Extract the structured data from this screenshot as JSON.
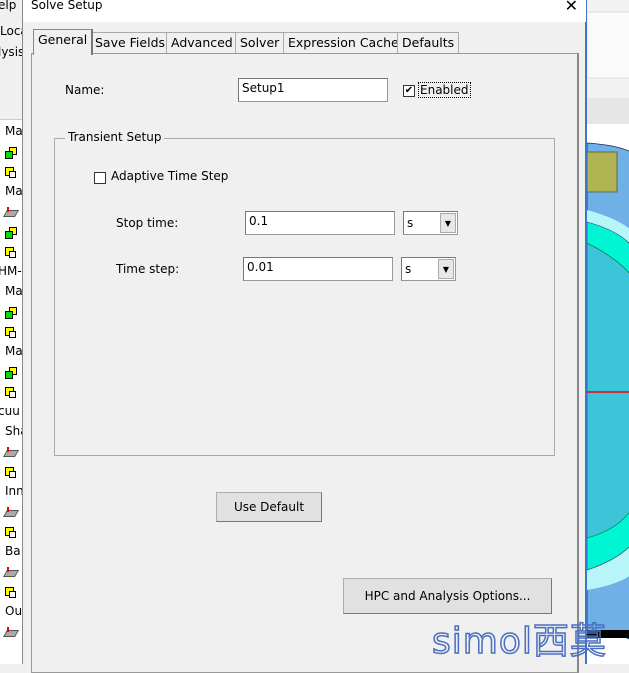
{
  "background": {
    "menu_fragment": "elp",
    "toolbar_fragments": [
      "Loca",
      "lysis"
    ],
    "tree_items": [
      {
        "type": "text",
        "text": "Ma"
      },
      {
        "type": "icon",
        "icon": "green-yellow-object-icon"
      },
      {
        "type": "icon",
        "icon": "yellow-object-icon"
      },
      {
        "type": "text",
        "text": "Ma"
      },
      {
        "type": "icon",
        "icon": "red-sheet-icon"
      },
      {
        "type": "icon",
        "icon": "green-yellow-object-icon"
      },
      {
        "type": "icon",
        "icon": "yellow-object-icon"
      },
      {
        "type": "text",
        "text": "HM-"
      },
      {
        "type": "text",
        "text": "Ma"
      },
      {
        "type": "icon",
        "icon": "green-yellow-object-icon"
      },
      {
        "type": "icon",
        "icon": "yellow-object-icon"
      },
      {
        "type": "text",
        "text": "Ma"
      },
      {
        "type": "icon",
        "icon": "green-yellow-object-icon"
      },
      {
        "type": "icon",
        "icon": "yellow-object-icon"
      },
      {
        "type": "text",
        "text": "cuu"
      },
      {
        "type": "text",
        "text": "Sha"
      },
      {
        "type": "icon",
        "icon": "red-sheet-icon"
      },
      {
        "type": "icon",
        "icon": "yellow-object-icon"
      },
      {
        "type": "text",
        "text": "Inn"
      },
      {
        "type": "icon",
        "icon": "red-sheet-icon"
      },
      {
        "type": "icon",
        "icon": "yellow-object-icon"
      },
      {
        "type": "text",
        "text": "Ba"
      },
      {
        "type": "icon",
        "icon": "red-sheet-icon"
      },
      {
        "type": "icon",
        "icon": "yellow-object-icon"
      },
      {
        "type": "text",
        "text": "Ou"
      },
      {
        "type": "icon",
        "icon": "red-sheet-icon"
      }
    ]
  },
  "dialog": {
    "title": "Solve Setup",
    "close_icon": "close-icon",
    "tabs": [
      {
        "label": "General",
        "active": true
      },
      {
        "label": "Save Fields",
        "active": false
      },
      {
        "label": "Advanced",
        "active": false
      },
      {
        "label": "Solver",
        "active": false
      },
      {
        "label": "Expression Cache",
        "active": false
      },
      {
        "label": "Defaults",
        "active": false
      }
    ],
    "name_label": "Name:",
    "name_value": "Setup1",
    "enabled_label": "Enabled",
    "enabled_checked": true,
    "group_title": "Transient Setup",
    "adaptive_label": "Adaptive Time Step",
    "adaptive_checked": false,
    "stop_time_label": "Stop time:",
    "stop_time_value": "0.1",
    "stop_time_unit": "s",
    "time_step_label": "Time step:",
    "time_step_value": "0.01",
    "time_step_unit": "s",
    "use_default_label": "Use Default",
    "hpc_label": "HPC and Analysis Options..."
  },
  "watermark": "simol西莫",
  "colors": {
    "dialog_bg": "#f0f0f0",
    "accent_border": "#3b78c4",
    "model_blue": "#6fb0e6",
    "model_cyan": "#00f5d4",
    "model_teal": "#3cc4d8",
    "model_olive": "#b0b452"
  }
}
